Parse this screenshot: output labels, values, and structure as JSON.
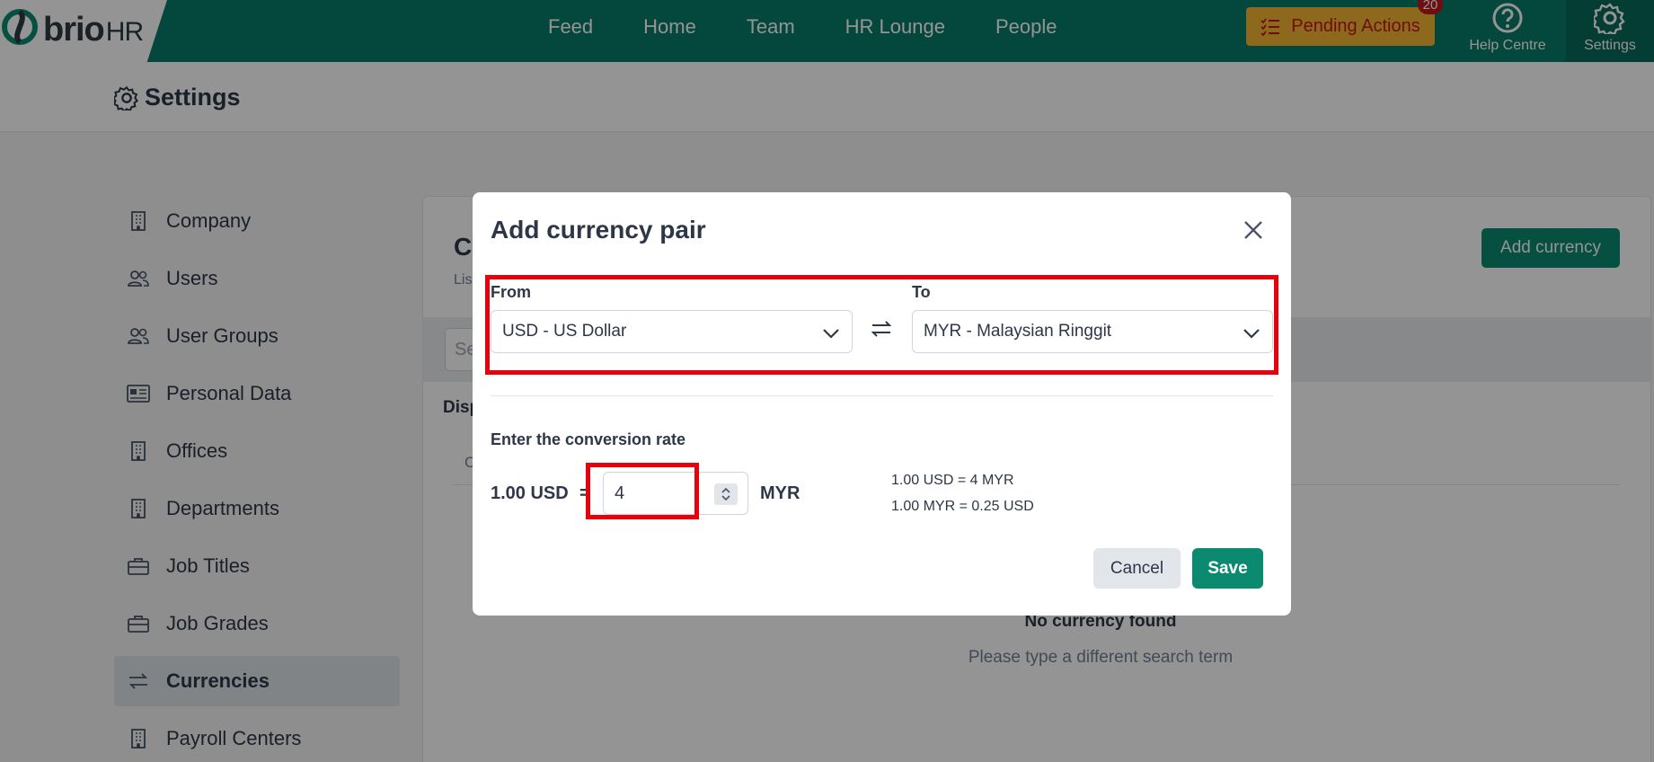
{
  "brand": {
    "name_bold": "brio",
    "name_light": "HR",
    "primary": "#087a68",
    "accent_green": "#0b8a70",
    "warning_bg": "#f2b531",
    "alert_red": "#c2181d"
  },
  "topnav": {
    "links": [
      "Feed",
      "Home",
      "Team",
      "HR Lounge",
      "People"
    ],
    "pending_label": "Pending Actions",
    "pending_count": "20",
    "help_label": "Help Centre",
    "settings_label": "Settings"
  },
  "page": {
    "title": "Settings"
  },
  "sidebar": {
    "items": [
      {
        "label": "Company",
        "icon": "building-icon"
      },
      {
        "label": "Users",
        "icon": "users-icon"
      },
      {
        "label": "User Groups",
        "icon": "users-icon"
      },
      {
        "label": "Personal Data",
        "icon": "id-card-icon"
      },
      {
        "label": "Offices",
        "icon": "building-icon"
      },
      {
        "label": "Departments",
        "icon": "building-icon"
      },
      {
        "label": "Job Titles",
        "icon": "briefcase-icon"
      },
      {
        "label": "Job Grades",
        "icon": "briefcase-icon"
      },
      {
        "label": "Currencies",
        "icon": "swap-icon",
        "active": true
      },
      {
        "label": "Payroll Centers",
        "icon": "building-icon"
      }
    ]
  },
  "main": {
    "title_partial": "C",
    "subtitle_partial": "Lis",
    "add_currency_label": "Add currency",
    "search_placeholder_partial": "Se",
    "display_label_partial": "Disp",
    "column_partial": "C",
    "empty_title": "No currency found",
    "empty_subtitle": "Please type a different search term"
  },
  "modal": {
    "title": "Add currency pair",
    "from_label": "From",
    "from_value": "USD - US Dollar",
    "to_label": "To",
    "to_value": "MYR - Malaysian Ringgit",
    "conversion_label": "Enter the conversion rate",
    "base_amount": "1.00 USD",
    "equals": "=",
    "rate_value": "4",
    "target_currency": "MYR",
    "calc_line_1": "1.00 USD  =  4  MYR",
    "calc_line_2": "1.00 MYR  =  0.25  USD",
    "cancel_label": "Cancel",
    "save_label": "Save"
  }
}
